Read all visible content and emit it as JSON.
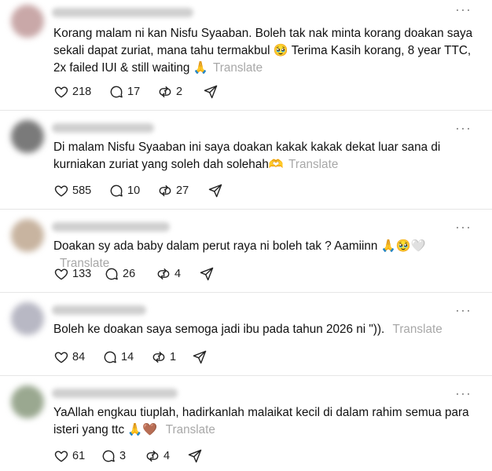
{
  "posts": [
    {
      "text": "Korang malam ni kan Nisfu Syaaban. Boleh tak nak minta korang doakan saya sekali dapat zuriat, mana tahu termakbul 🥹 Terima Kasih korang, 8 year TTC, 2x failed IUI & still waiting 🙏",
      "translate": "Translate",
      "likes": "218",
      "replies": "17",
      "reposts": "2",
      "avatar_color": "#c9a8a8"
    },
    {
      "text": "Di malam Nisfu Syaaban ini saya doakan kakak kakak dekat luar sana di kurniakan zuriat yang soleh dah solehah🫶",
      "translate": "Translate",
      "likes": "585",
      "replies": "10",
      "reposts": "27",
      "avatar_color": "#7a7a7a"
    },
    {
      "text": "Doakan sy ada baby dalam perut raya ni boleh tak ? Aamiinn 🙏🥹🤍",
      "translate": "Translate",
      "likes": "133",
      "replies": "26",
      "reposts": "4",
      "avatar_color": "#c8b4a0"
    },
    {
      "text": "Boleh ke doakan saya semoga jadi ibu pada tahun 2026 ni \")).",
      "translate": "Translate",
      "likes": "84",
      "replies": "14",
      "reposts": "1",
      "avatar_color": "#b8b8c4"
    },
    {
      "text": "YaAllah engkau tiuplah, hadirkanlah malaikat kecil di dalam rahim semua para isteri yang ttc 🙏🤎",
      "translate": "Translate",
      "likes": "61",
      "replies": "3",
      "reposts": "4",
      "avatar_color": "#9aa890"
    }
  ],
  "icons": {
    "more": "more-icon",
    "like": "heart-icon",
    "reply": "comment-icon",
    "repost": "repost-icon",
    "share": "share-icon"
  }
}
